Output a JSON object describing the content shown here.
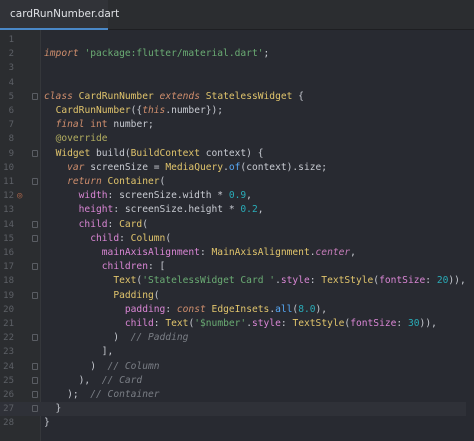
{
  "tab": {
    "filename": "cardRunNumber.dart",
    "icon": "dart-file-icon"
  },
  "gutter_marker_line": 12,
  "current_line": 27,
  "lines": [
    {
      "n": "1",
      "fold": false,
      "tokens": []
    },
    {
      "n": "2",
      "fold": false,
      "tokens": [
        [
          "kw",
          "import"
        ],
        [
          "",
          " "
        ],
        [
          "str",
          "'package:flutter/material.dart'"
        ],
        [
          "",
          ";"
        ]
      ]
    },
    {
      "n": "3",
      "fold": false,
      "tokens": []
    },
    {
      "n": "4",
      "fold": false,
      "tokens": []
    },
    {
      "n": "5",
      "fold": true,
      "tokens": [
        [
          "kw",
          "class"
        ],
        [
          "",
          " "
        ],
        [
          "cls",
          "CardRunNumber"
        ],
        [
          "",
          " "
        ],
        [
          "kw",
          "extends"
        ],
        [
          "",
          " "
        ],
        [
          "cls",
          "StatelessWidget"
        ],
        [
          "",
          " {"
        ]
      ]
    },
    {
      "n": "6",
      "fold": false,
      "tokens": [
        [
          "",
          "  "
        ],
        [
          "cls",
          "CardRunNumber"
        ],
        [
          "",
          "({"
        ],
        [
          "kw",
          "this"
        ],
        [
          "",
          ".number});"
        ]
      ]
    },
    {
      "n": "7",
      "fold": false,
      "tokens": [
        [
          "",
          "  "
        ],
        [
          "kw",
          "final"
        ],
        [
          "",
          " "
        ],
        [
          "kwn",
          "int"
        ],
        [
          "",
          " number;"
        ]
      ]
    },
    {
      "n": "8",
      "fold": false,
      "tokens": [
        [
          "",
          "  "
        ],
        [
          "ann",
          "@override"
        ]
      ]
    },
    {
      "n": "9",
      "fold": true,
      "tokens": [
        [
          "",
          "  "
        ],
        [
          "cls",
          "Widget"
        ],
        [
          "",
          " build("
        ],
        [
          "cls",
          "BuildContext"
        ],
        [
          "",
          " context) {"
        ]
      ]
    },
    {
      "n": "10",
      "fold": false,
      "tokens": [
        [
          "",
          "    "
        ],
        [
          "kw",
          "var"
        ],
        [
          "",
          " screenSize = "
        ],
        [
          "cls",
          "MediaQuery"
        ],
        [
          "",
          "."
        ],
        [
          "fn",
          "of"
        ],
        [
          "",
          "(context).size;"
        ]
      ]
    },
    {
      "n": "11",
      "fold": true,
      "tokens": [
        [
          "",
          "    "
        ],
        [
          "kw",
          "return"
        ],
        [
          "",
          " "
        ],
        [
          "cls",
          "Container"
        ],
        [
          "",
          "("
        ]
      ]
    },
    {
      "n": "12",
      "fold": false,
      "tokens": [
        [
          "",
          "      "
        ],
        [
          "prop",
          "width"
        ],
        [
          "",
          ": screenSize.width * "
        ],
        [
          "num",
          "0.9"
        ],
        [
          "",
          ","
        ]
      ]
    },
    {
      "n": "13",
      "fold": false,
      "tokens": [
        [
          "",
          "      "
        ],
        [
          "prop",
          "height"
        ],
        [
          "",
          ": screenSize.height * "
        ],
        [
          "num",
          "0.2"
        ],
        [
          "",
          ","
        ]
      ]
    },
    {
      "n": "14",
      "fold": true,
      "tokens": [
        [
          "",
          "      "
        ],
        [
          "prop",
          "child"
        ],
        [
          "",
          ": "
        ],
        [
          "cls",
          "Card"
        ],
        [
          "",
          "("
        ]
      ]
    },
    {
      "n": "15",
      "fold": true,
      "tokens": [
        [
          "",
          "        "
        ],
        [
          "prop",
          "child"
        ],
        [
          "",
          ": "
        ],
        [
          "cls",
          "Column"
        ],
        [
          "",
          "("
        ]
      ]
    },
    {
      "n": "16",
      "fold": false,
      "tokens": [
        [
          "",
          "          "
        ],
        [
          "prop",
          "mainAxisAlignment"
        ],
        [
          "",
          ": "
        ],
        [
          "cls",
          "MainAxisAlignment"
        ],
        [
          "",
          "."
        ],
        [
          "st",
          "center"
        ],
        [
          "",
          ","
        ]
      ]
    },
    {
      "n": "17",
      "fold": true,
      "tokens": [
        [
          "",
          "          "
        ],
        [
          "prop",
          "children"
        ],
        [
          "",
          ": ["
        ]
      ]
    },
    {
      "n": "18",
      "fold": false,
      "tokens": [
        [
          "",
          "            "
        ],
        [
          "cls",
          "Text"
        ],
        [
          "",
          "("
        ],
        [
          "str",
          "'StatelessWidget Card '"
        ],
        [
          "",
          "."
        ],
        [
          "prop",
          "style"
        ],
        [
          "",
          ": "
        ],
        [
          "cls",
          "TextStyle"
        ],
        [
          "",
          "("
        ],
        [
          "prop",
          "fontSize"
        ],
        [
          "",
          ": "
        ],
        [
          "num",
          "20"
        ],
        [
          "",
          ")),"
        ]
      ]
    },
    {
      "n": "19",
      "fold": true,
      "tokens": [
        [
          "",
          "            "
        ],
        [
          "cls",
          "Padding"
        ],
        [
          "",
          "("
        ]
      ]
    },
    {
      "n": "20",
      "fold": false,
      "tokens": [
        [
          "",
          "              "
        ],
        [
          "prop",
          "padding"
        ],
        [
          "",
          ": "
        ],
        [
          "kw",
          "const"
        ],
        [
          "",
          " "
        ],
        [
          "cls",
          "EdgeInsets"
        ],
        [
          "",
          "."
        ],
        [
          "fn",
          "all"
        ],
        [
          "",
          "("
        ],
        [
          "num",
          "8.0"
        ],
        [
          "",
          "),"
        ]
      ]
    },
    {
      "n": "21",
      "fold": false,
      "tokens": [
        [
          "",
          "              "
        ],
        [
          "prop",
          "child"
        ],
        [
          "",
          ": "
        ],
        [
          "cls",
          "Text"
        ],
        [
          "",
          "("
        ],
        [
          "str",
          "'$number'"
        ],
        [
          "",
          "."
        ],
        [
          "prop",
          "style"
        ],
        [
          "",
          ": "
        ],
        [
          "cls",
          "TextStyle"
        ],
        [
          "",
          "("
        ],
        [
          "prop",
          "fontSize"
        ],
        [
          "",
          ": "
        ],
        [
          "num",
          "30"
        ],
        [
          "",
          ")),"
        ]
      ]
    },
    {
      "n": "22",
      "fold": true,
      "tokens": [
        [
          "",
          "            )  "
        ],
        [
          "cm",
          "// Padding"
        ]
      ]
    },
    {
      "n": "23",
      "fold": false,
      "tokens": [
        [
          "",
          "          ],"
        ]
      ]
    },
    {
      "n": "24",
      "fold": true,
      "tokens": [
        [
          "",
          "        )  "
        ],
        [
          "cm",
          "// Column"
        ]
      ]
    },
    {
      "n": "25",
      "fold": true,
      "tokens": [
        [
          "",
          "      ),  "
        ],
        [
          "cm",
          "// Card"
        ]
      ]
    },
    {
      "n": "26",
      "fold": true,
      "tokens": [
        [
          "",
          "    );  "
        ],
        [
          "cm",
          "// Container"
        ]
      ]
    },
    {
      "n": "27",
      "fold": true,
      "tokens": [
        [
          "",
          "  }"
        ]
      ]
    },
    {
      "n": "28",
      "fold": false,
      "tokens": [
        [
          "",
          "}"
        ]
      ]
    }
  ]
}
